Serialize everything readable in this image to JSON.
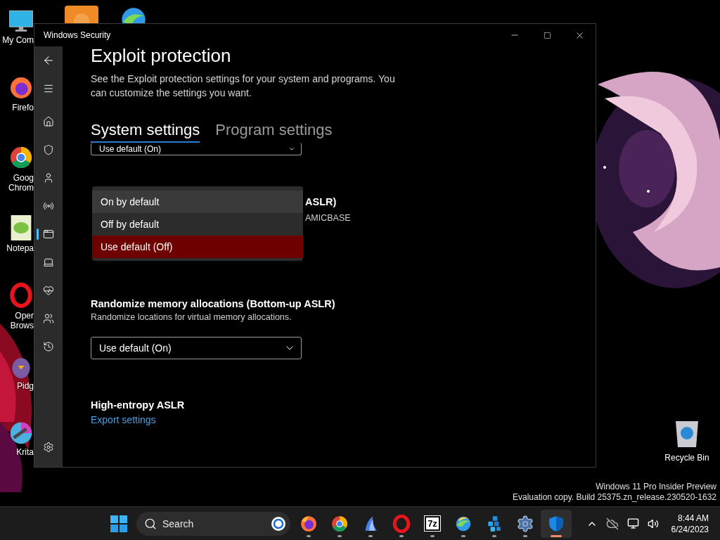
{
  "desktop": {
    "icons": [
      {
        "kind": "computer",
        "label": "My Com"
      },
      {
        "kind": "fox",
        "label": "Firefo"
      },
      {
        "kind": "tricolor",
        "label": "Goog Chrom"
      },
      {
        "kind": "notepad",
        "label": "Notepa"
      },
      {
        "kind": "ring",
        "label": "Oper Brows"
      },
      {
        "kind": "bird",
        "label": "Pidg"
      },
      {
        "kind": "brush",
        "label": "Krita"
      },
      {
        "kind": "flame"
      },
      {
        "kind": "globe"
      }
    ],
    "recycle_bin": {
      "label": "Recycle Bin"
    },
    "os_notice": [
      "Windows 11 Pro Insider Preview",
      "Evaluation copy. Build 25375.zn_release.230520-1632"
    ]
  },
  "window": {
    "title": "Windows Security"
  },
  "sidebar": {
    "top": [
      {
        "kind": "back"
      },
      {
        "kind": "menu"
      }
    ],
    "items": [
      {
        "kind": "home",
        "selected": false
      },
      {
        "kind": "shield",
        "selected": false
      },
      {
        "kind": "account",
        "selected": false
      },
      {
        "kind": "network",
        "selected": false
      },
      {
        "kind": "browser",
        "selected": true
      },
      {
        "kind": "device",
        "selected": false
      },
      {
        "kind": "health",
        "selected": false
      },
      {
        "kind": "family",
        "selected": false
      },
      {
        "kind": "history",
        "selected": false
      }
    ],
    "bottom": {
      "kind": "settings"
    }
  },
  "content": {
    "title": "Exploit protection",
    "description": "See the Exploit protection settings for your system and programs.  You can customize the settings you want.",
    "tabs": [
      {
        "label": "System settings",
        "selected": true
      },
      {
        "label": "Program settings",
        "selected": false
      }
    ],
    "partial_dropdown": {
      "value": "Use default (On)"
    },
    "open_dropdown": {
      "options": [
        {
          "label": "On by default",
          "selected": false,
          "hovered": true
        },
        {
          "label": "Off by default",
          "selected": false,
          "hovered": false
        },
        {
          "label": "Use default (Off)",
          "selected": true,
          "hovered": false
        }
      ],
      "covered_heading": "ASLR)",
      "covered_description": "AMICBASE"
    },
    "settings": [
      {
        "title": "Randomize memory allocations (Bottom-up ASLR)",
        "description": "Randomize locations for virtual memory allocations.",
        "value": "Use default (On)"
      }
    ],
    "cut_heading": "High-entropy ASLR",
    "export_link": "Export settings"
  },
  "taskbar": {
    "search": {
      "placeholder": "Search"
    },
    "apps": [
      {
        "kind": "fox",
        "active": false
      },
      {
        "kind": "tricolor",
        "active": false
      },
      {
        "kind": "fin",
        "active": false
      },
      {
        "kind": "ring",
        "active": false
      },
      {
        "kind": "archiver",
        "text": "7z",
        "active": false
      },
      {
        "kind": "globe",
        "active": false
      },
      {
        "kind": "cubes",
        "active": false
      },
      {
        "kind": "gear",
        "active": false
      },
      {
        "kind": "shield",
        "active": true
      }
    ],
    "tray": {
      "time": "8:44 AM",
      "date": "6/24/2023"
    }
  }
}
